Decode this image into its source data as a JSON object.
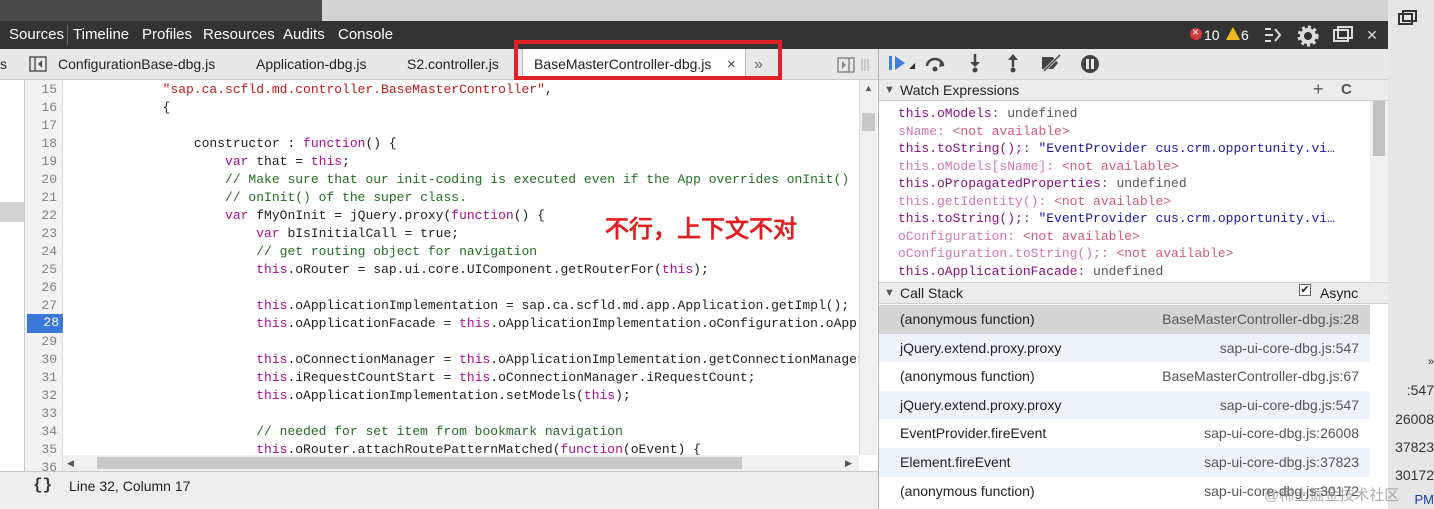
{
  "toolbar": {
    "tabs": [
      "Sources",
      "Timeline",
      "Profiles",
      "Resources",
      "Audits",
      "Console"
    ],
    "error_count": "10",
    "warning_count": "6"
  },
  "file_tabs": {
    "left_fragment": "s",
    "items": [
      "ConfigurationBase-dbg.js",
      "Application-dbg.js",
      "S2.controller.js",
      "BaseMasterController-dbg.js"
    ],
    "active_close": "×",
    "overflow": "»"
  },
  "code": {
    "line_numbers": [
      "15",
      "16",
      "17",
      "18",
      "19",
      "20",
      "21",
      "22",
      "23",
      "24",
      "25",
      "26",
      "27",
      "28",
      "29",
      "30",
      "31",
      "32",
      "33",
      "34",
      "35",
      "36"
    ],
    "current_line": "28"
  },
  "annotation": "不行，上下文不对",
  "status_bar": {
    "braces": "{}",
    "position": "Line 32, Column 17"
  },
  "watch": {
    "title": "Watch Expressions",
    "add": "+",
    "refresh": "C",
    "items": [
      {
        "name": "this.oModels",
        "sep": ": ",
        "value": "undefined",
        "kind": "plain"
      },
      {
        "name": "sName",
        "sep": ": ",
        "value": "<not available>",
        "kind": "na"
      },
      {
        "name": "this.toString();",
        "sep": ": ",
        "value": "\"EventProvider cus.crm.opportunity.vi…",
        "kind": "str"
      },
      {
        "name": "this.oModels[sName]",
        "sep": ": ",
        "value": "<not available>",
        "kind": "na"
      },
      {
        "name": "this.oPropagatedProperties",
        "sep": ": ",
        "value": "undefined",
        "kind": "plain"
      },
      {
        "name": "this.getIdentity()",
        "sep": ": ",
        "value": "<not available>",
        "kind": "na"
      },
      {
        "name": "this.toString();",
        "sep": ": ",
        "value": "\"EventProvider cus.crm.opportunity.vi…",
        "kind": "str"
      },
      {
        "name": "oConfiguration",
        "sep": ": ",
        "value": "<not available>",
        "kind": "na"
      },
      {
        "name": "oConfiguration.toString();",
        "sep": ": ",
        "value": "<not available>",
        "kind": "na"
      },
      {
        "name": "this.oApplicationFacade",
        "sep": ": ",
        "value": "undefined",
        "kind": "plain"
      }
    ]
  },
  "callstack": {
    "title": "Call Stack",
    "async_label": "Async",
    "async_checked": "✔",
    "frames": [
      {
        "fn": "(anonymous function)",
        "loc": "BaseMasterController-dbg.js:28"
      },
      {
        "fn": "jQuery.extend.proxy.proxy",
        "loc": "sap-ui-core-dbg.js:547"
      },
      {
        "fn": "(anonymous function)",
        "loc": "BaseMasterController-dbg.js:67"
      },
      {
        "fn": "jQuery.extend.proxy.proxy",
        "loc": "sap-ui-core-dbg.js:547"
      },
      {
        "fn": "EventProvider.fireEvent",
        "loc": "sap-ui-core-dbg.js:26008"
      },
      {
        "fn": "Element.fireEvent",
        "loc": "sap-ui-core-dbg.js:37823"
      },
      {
        "fn": "(anonymous function)",
        "loc": "sap-ui-core-dbg.js:30172"
      }
    ]
  },
  "desktop_fragments": [
    "»",
    ":547",
    "26008",
    "37823",
    "30172",
    "PM"
  ],
  "watermark": "@稀土掘金技术社区"
}
